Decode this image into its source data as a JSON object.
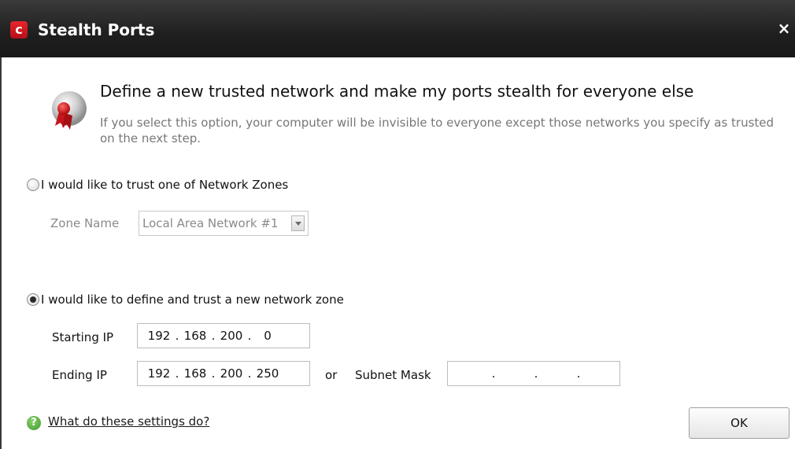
{
  "window": {
    "title": "Stealth Ports",
    "logo_glyph": "c",
    "close_glyph": "×",
    "accent_color": "#e8262b"
  },
  "header": {
    "title": "Define a new trusted network and make my ports stealth for everyone else",
    "description": "If you select this option, your computer will be invisible to everyone except those networks you specify as trusted on the next step.",
    "icon": "badge-icon"
  },
  "option_zones": {
    "label": "I would like to trust one of Network Zones",
    "checked": false,
    "zone_name_label": "Zone Name",
    "zone_name_value": "Local Area Network #1"
  },
  "option_new": {
    "label": "I would like to define and trust a new network zone",
    "checked": true,
    "starting_ip_label": "Starting IP",
    "starting_ip": [
      "192",
      "168",
      "200",
      "0"
    ],
    "ending_ip_label": "Ending IP",
    "ending_ip": [
      "192",
      "168",
      "200",
      "250"
    ],
    "or_label": "or",
    "subnet_mask_label": "Subnet Mask",
    "subnet_mask": [
      "",
      "",
      "",
      ""
    ]
  },
  "footer": {
    "help_icon": "question-icon",
    "help_glyph": "?",
    "help_link": "What do these settings do?",
    "ok_label": "OK"
  }
}
